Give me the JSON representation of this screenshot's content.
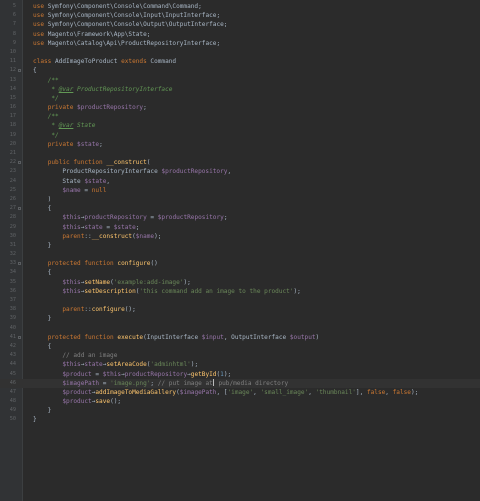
{
  "editor": {
    "language": "php",
    "theme_colors": {
      "background": "#2b2b2b",
      "keyword": "#cc7832",
      "variable": "#9876aa",
      "function": "#ffc66d",
      "string": "#6a8759",
      "comment": "#808080",
      "docblock": "#629755"
    },
    "current_line": 46,
    "lines": [
      {
        "n": "5",
        "t": [
          [
            "k",
            "use "
          ],
          [
            "o",
            "Symfony\\Component\\Console\\Command\\Command;"
          ]
        ]
      },
      {
        "n": "6",
        "t": [
          [
            "k",
            "use "
          ],
          [
            "o",
            "Symfony\\Component\\Console\\Input\\InputInterface;"
          ]
        ]
      },
      {
        "n": "7",
        "t": [
          [
            "k",
            "use "
          ],
          [
            "o",
            "Symfony\\Component\\Console\\Output\\OutputInterface;"
          ]
        ]
      },
      {
        "n": "8",
        "t": [
          [
            "k",
            "use "
          ],
          [
            "o",
            "Magento\\Framework\\App\\State;"
          ]
        ]
      },
      {
        "n": "9",
        "t": [
          [
            "k",
            "use "
          ],
          [
            "o",
            "Magento\\Catalog\\Api\\ProductRepositoryInterface;"
          ]
        ]
      },
      {
        "n": "10",
        "t": []
      },
      {
        "n": "11",
        "t": [
          [
            "k",
            "class "
          ],
          [
            "o",
            "AddImageToProduct "
          ],
          [
            "k",
            "extends "
          ],
          [
            "o",
            "Command"
          ]
        ]
      },
      {
        "n": "12",
        "fold": true,
        "t": [
          [
            "o",
            "{"
          ]
        ]
      },
      {
        "n": "13",
        "t": [
          [
            "o",
            "    "
          ],
          [
            "d",
            "/**"
          ]
        ]
      },
      {
        "n": "14",
        "t": [
          [
            "o",
            "     "
          ],
          [
            "d",
            "* "
          ],
          [
            "dt",
            "@var"
          ],
          [
            "d",
            " ProductRepositoryInterface"
          ]
        ]
      },
      {
        "n": "15",
        "t": [
          [
            "o",
            "     "
          ],
          [
            "d",
            "*/"
          ]
        ]
      },
      {
        "n": "16",
        "t": [
          [
            "o",
            "    "
          ],
          [
            "k",
            "private "
          ],
          [
            "v",
            "$productRepository"
          ],
          [
            "o",
            ";"
          ]
        ]
      },
      {
        "n": "17",
        "t": [
          [
            "o",
            "    "
          ],
          [
            "d",
            "/**"
          ]
        ]
      },
      {
        "n": "18",
        "t": [
          [
            "o",
            "     "
          ],
          [
            "d",
            "* "
          ],
          [
            "dt",
            "@var"
          ],
          [
            "d",
            " State"
          ]
        ]
      },
      {
        "n": "19",
        "t": [
          [
            "o",
            "     "
          ],
          [
            "d",
            "*/"
          ]
        ]
      },
      {
        "n": "20",
        "t": [
          [
            "o",
            "    "
          ],
          [
            "k",
            "private "
          ],
          [
            "v",
            "$state"
          ],
          [
            "o",
            ";"
          ]
        ]
      },
      {
        "n": "21",
        "t": []
      },
      {
        "n": "22",
        "fold": true,
        "t": [
          [
            "o",
            "    "
          ],
          [
            "k",
            "public function "
          ],
          [
            "f",
            "__construct"
          ],
          [
            "o",
            "("
          ]
        ]
      },
      {
        "n": "23",
        "t": [
          [
            "o",
            "        ProductRepositoryInterface "
          ],
          [
            "v",
            "$productRepository"
          ],
          [
            "o",
            ","
          ]
        ]
      },
      {
        "n": "24",
        "t": [
          [
            "o",
            "        State "
          ],
          [
            "v",
            "$state"
          ],
          [
            "o",
            ","
          ]
        ]
      },
      {
        "n": "25",
        "t": [
          [
            "o",
            "        "
          ],
          [
            "v",
            "$name"
          ],
          [
            "o",
            " = "
          ],
          [
            "k",
            "null"
          ]
        ]
      },
      {
        "n": "26",
        "t": [
          [
            "o",
            "    )"
          ]
        ]
      },
      {
        "n": "27",
        "fold": true,
        "t": [
          [
            "o",
            "    {"
          ]
        ]
      },
      {
        "n": "28",
        "t": [
          [
            "o",
            "        "
          ],
          [
            "v",
            "$this"
          ],
          [
            "o",
            "→"
          ],
          [
            "v",
            "productRepository"
          ],
          [
            "o",
            " = "
          ],
          [
            "v",
            "$productRepository"
          ],
          [
            "o",
            ";"
          ]
        ]
      },
      {
        "n": "29",
        "t": [
          [
            "o",
            "        "
          ],
          [
            "v",
            "$this"
          ],
          [
            "o",
            "→"
          ],
          [
            "v",
            "state"
          ],
          [
            "o",
            " = "
          ],
          [
            "v",
            "$state"
          ],
          [
            "o",
            ";"
          ]
        ]
      },
      {
        "n": "30",
        "t": [
          [
            "o",
            "        "
          ],
          [
            "k",
            "parent"
          ],
          [
            "o",
            "::"
          ],
          [
            "f",
            "__construct"
          ],
          [
            "o",
            "("
          ],
          [
            "v",
            "$name"
          ],
          [
            "o",
            ");"
          ]
        ]
      },
      {
        "n": "31",
        "t": [
          [
            "o",
            "    }"
          ]
        ]
      },
      {
        "n": "32",
        "t": []
      },
      {
        "n": "33",
        "fold": true,
        "t": [
          [
            "o",
            "    "
          ],
          [
            "k",
            "protected function "
          ],
          [
            "f",
            "configure"
          ],
          [
            "o",
            "()"
          ]
        ]
      },
      {
        "n": "34",
        "t": [
          [
            "o",
            "    {"
          ]
        ]
      },
      {
        "n": "35",
        "t": [
          [
            "o",
            "        "
          ],
          [
            "v",
            "$this"
          ],
          [
            "o",
            "→"
          ],
          [
            "f",
            "setName"
          ],
          [
            "o",
            "("
          ],
          [
            "s",
            "'example:add-image'"
          ],
          [
            "o",
            ");"
          ]
        ]
      },
      {
        "n": "36",
        "t": [
          [
            "o",
            "        "
          ],
          [
            "v",
            "$this"
          ],
          [
            "o",
            "→"
          ],
          [
            "f",
            "setDescription"
          ],
          [
            "o",
            "("
          ],
          [
            "s",
            "'this command add an image to the product'"
          ],
          [
            "o",
            ");"
          ]
        ]
      },
      {
        "n": "37",
        "t": []
      },
      {
        "n": "38",
        "t": [
          [
            "o",
            "        "
          ],
          [
            "k",
            "parent"
          ],
          [
            "o",
            "::"
          ],
          [
            "f",
            "configure"
          ],
          [
            "o",
            "();"
          ]
        ]
      },
      {
        "n": "39",
        "t": [
          [
            "o",
            "    }"
          ]
        ]
      },
      {
        "n": "40",
        "t": []
      },
      {
        "n": "41",
        "fold": true,
        "t": [
          [
            "o",
            "    "
          ],
          [
            "k",
            "protected function "
          ],
          [
            "f",
            "execute"
          ],
          [
            "o",
            "(InputInterface "
          ],
          [
            "v",
            "$input"
          ],
          [
            "o",
            ", OutputInterface "
          ],
          [
            "v",
            "$output"
          ],
          [
            "o",
            ")"
          ]
        ]
      },
      {
        "n": "42",
        "t": [
          [
            "o",
            "    {"
          ]
        ]
      },
      {
        "n": "43",
        "t": [
          [
            "o",
            "        "
          ],
          [
            "c",
            "// add an image"
          ]
        ]
      },
      {
        "n": "44",
        "t": [
          [
            "o",
            "        "
          ],
          [
            "v",
            "$this"
          ],
          [
            "o",
            "→"
          ],
          [
            "v",
            "state"
          ],
          [
            "o",
            "→"
          ],
          [
            "f",
            "setAreaCode"
          ],
          [
            "o",
            "("
          ],
          [
            "s",
            "'adminhtml'"
          ],
          [
            "o",
            ");"
          ]
        ]
      },
      {
        "n": "45",
        "t": [
          [
            "o",
            "        "
          ],
          [
            "v",
            "$product"
          ],
          [
            "o",
            " = "
          ],
          [
            "v",
            "$this"
          ],
          [
            "o",
            "→"
          ],
          [
            "v",
            "productRepository"
          ],
          [
            "o",
            "→"
          ],
          [
            "f",
            "getById"
          ],
          [
            "o",
            "("
          ],
          [
            "n",
            "1"
          ],
          [
            "o",
            ");"
          ]
        ]
      },
      {
        "n": "46",
        "caret_before": "pub/media directory",
        "t": [
          [
            "o",
            "        "
          ],
          [
            "v",
            "$imagePath"
          ],
          [
            "o",
            " = "
          ],
          [
            "s",
            "'image.png'"
          ],
          [
            "o",
            "; "
          ],
          [
            "c",
            "// put image at"
          ],
          [
            "caret",
            ""
          ],
          [
            "c",
            " pub/media directory"
          ]
        ]
      },
      {
        "n": "47",
        "t": [
          [
            "o",
            "        "
          ],
          [
            "v",
            "$product"
          ],
          [
            "o",
            "→"
          ],
          [
            "f",
            "addImageToMediaGallery"
          ],
          [
            "o",
            "("
          ],
          [
            "v",
            "$imagePath"
          ],
          [
            "o",
            ", ["
          ],
          [
            "s",
            "'image'"
          ],
          [
            "o",
            ", "
          ],
          [
            "s",
            "'small_image'"
          ],
          [
            "o",
            ", "
          ],
          [
            "s",
            "'thumbnail'"
          ],
          [
            "o",
            "], "
          ],
          [
            "k",
            "false"
          ],
          [
            "o",
            ", "
          ],
          [
            "k",
            "false"
          ],
          [
            "o",
            ");"
          ]
        ]
      },
      {
        "n": "48",
        "t": [
          [
            "o",
            "        "
          ],
          [
            "v",
            "$product"
          ],
          [
            "o",
            "→"
          ],
          [
            "f",
            "save"
          ],
          [
            "o",
            "();"
          ]
        ]
      },
      {
        "n": "49",
        "t": [
          [
            "o",
            "    }"
          ]
        ]
      },
      {
        "n": "50",
        "t": [
          [
            "o",
            "}"
          ]
        ]
      }
    ]
  }
}
